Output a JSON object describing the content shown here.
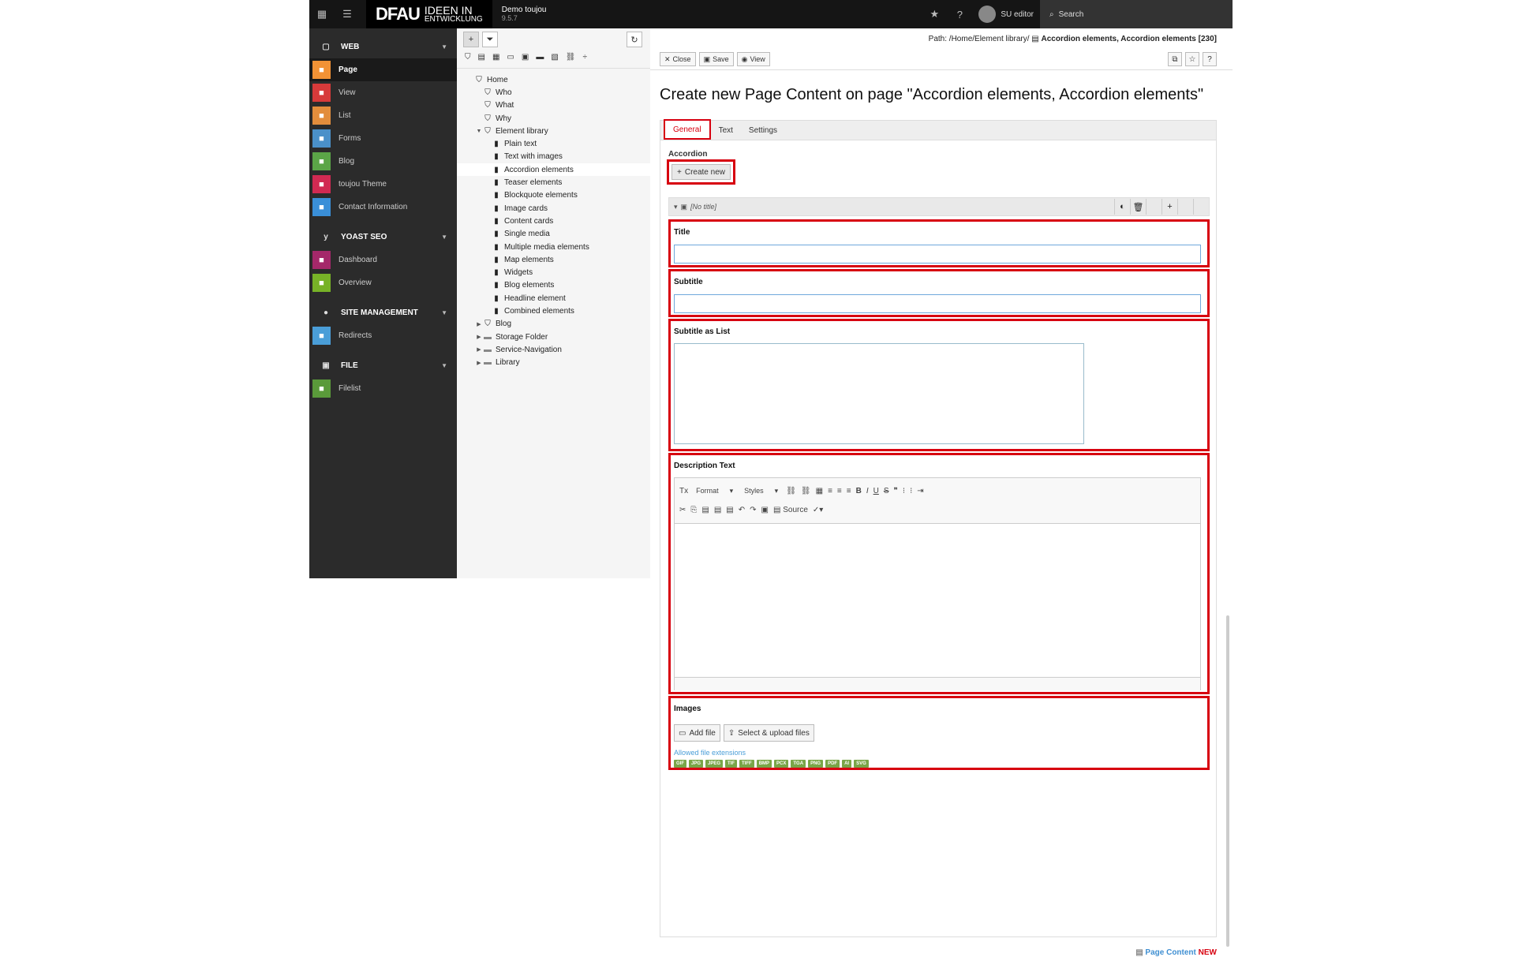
{
  "topbar": {
    "logo_main": "DFAU",
    "logo_sub_1": "IDEEN IN",
    "logo_sub_2": "ENTWICKLUNG",
    "site_name": "Demo toujou",
    "version": "9.5.7",
    "user": "SU editor",
    "search_label": "Search"
  },
  "modules": {
    "web": {
      "header": "WEB",
      "items": [
        {
          "label": "Page",
          "icon": "page-icon",
          "color": "#f29235"
        },
        {
          "label": "View",
          "icon": "eye-icon",
          "color": "#d73a3a"
        },
        {
          "label": "List",
          "icon": "list-icon",
          "color": "#e28d3c"
        },
        {
          "label": "Forms",
          "icon": "forms-icon",
          "color": "#4a90c9"
        },
        {
          "label": "Blog",
          "icon": "blog-icon",
          "color": "#5ba547"
        },
        {
          "label": "toujou Theme",
          "icon": "fingerprint-icon",
          "color": "#d12a52"
        },
        {
          "label": "Contact Information",
          "icon": "contact-icon",
          "color": "#3a8fd8"
        }
      ]
    },
    "yoast": {
      "header": "YOAST SEO",
      "items": [
        {
          "label": "Dashboard",
          "icon": "info-icon",
          "color": "#a4286a"
        },
        {
          "label": "Overview",
          "icon": "overview-icon",
          "color": "#77b227"
        }
      ]
    },
    "site": {
      "header": "SITE MANAGEMENT",
      "items": [
        {
          "label": "Redirects",
          "icon": "redirect-icon",
          "color": "#4a9ed8"
        }
      ]
    },
    "file": {
      "header": "FILE",
      "items": [
        {
          "label": "Filelist",
          "icon": "filelist-icon",
          "color": "#5a9a3a"
        }
      ]
    }
  },
  "tree": {
    "nodes": [
      {
        "label": "Home",
        "level": 0,
        "exp": ""
      },
      {
        "label": "Who",
        "level": 1,
        "exp": ""
      },
      {
        "label": "What",
        "level": 1,
        "exp": ""
      },
      {
        "label": "Why",
        "level": 1,
        "exp": ""
      },
      {
        "label": "Element library",
        "level": 1,
        "exp": "▼"
      },
      {
        "label": "Plain text",
        "level": 2,
        "exp": ""
      },
      {
        "label": "Text with images",
        "level": 2,
        "exp": ""
      },
      {
        "label": "Accordion elements",
        "level": 2,
        "exp": "",
        "selected": true
      },
      {
        "label": "Teaser elements",
        "level": 2,
        "exp": ""
      },
      {
        "label": "Blockquote elements",
        "level": 2,
        "exp": ""
      },
      {
        "label": "Image cards",
        "level": 2,
        "exp": ""
      },
      {
        "label": "Content cards",
        "level": 2,
        "exp": ""
      },
      {
        "label": "Single media",
        "level": 2,
        "exp": ""
      },
      {
        "label": "Multiple media elements",
        "level": 2,
        "exp": ""
      },
      {
        "label": "Map elements",
        "level": 2,
        "exp": ""
      },
      {
        "label": "Widgets",
        "level": 2,
        "exp": ""
      },
      {
        "label": "Blog elements",
        "level": 2,
        "exp": ""
      },
      {
        "label": "Headline element",
        "level": 2,
        "exp": ""
      },
      {
        "label": "Combined elements",
        "level": 2,
        "exp": ""
      },
      {
        "label": "Blog",
        "level": 1,
        "exp": "▶"
      },
      {
        "label": "Storage Folder",
        "level": 1,
        "exp": "▶",
        "folder": true
      },
      {
        "label": "Service-Navigation",
        "level": 1,
        "exp": "▶",
        "folder": true
      },
      {
        "label": "Library",
        "level": 1,
        "exp": "▶",
        "folder": true
      }
    ]
  },
  "docheader": {
    "path_prefix": "Path: /Home/Element library/",
    "path_current": "Accordion elements, Accordion elements [230]",
    "close": "Close",
    "save": "Save",
    "view": "View"
  },
  "form": {
    "heading": "Create new Page Content on page \"Accordion elements, Accordion elements\"",
    "tabs": [
      "General",
      "Text",
      "Settings"
    ],
    "accordion_label": "Accordion",
    "create_new": "Create new",
    "inline_title": "[No title]",
    "title_label": "Title",
    "subtitle_label": "Subtitle",
    "subtitle_list_label": "Subtitle as List",
    "description_label": "Description Text",
    "rte_format": "Format",
    "rte_styles": "Styles",
    "rte_source": "Source",
    "images_label": "Images",
    "add_file": "Add file",
    "select_upload": "Select & upload files",
    "allowed_ext_label": "Allowed file extensions",
    "extensions": [
      "GIF",
      "JPG",
      "JPEG",
      "TIF",
      "TIFF",
      "BMP",
      "PCX",
      "TGA",
      "PNG",
      "PDF",
      "AI",
      "SVG"
    ]
  },
  "footer": {
    "record_type": "Page Content",
    "state": "NEW"
  },
  "colors": {
    "highlight": "#d7000f",
    "ext_badge": "#79a548",
    "link": "#4a9ed8"
  }
}
